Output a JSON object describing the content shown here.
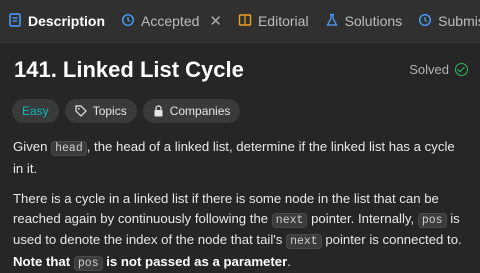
{
  "tabs": [
    {
      "label": "Description",
      "icon": "document-icon"
    },
    {
      "label": "Accepted",
      "icon": "history-icon"
    },
    {
      "label": "Editorial",
      "icon": "book-icon"
    },
    {
      "label": "Solutions",
      "icon": "flask-icon"
    },
    {
      "label": "Submissions",
      "icon": "history-icon"
    }
  ],
  "close_glyph": "✕",
  "problem": {
    "title": "141. Linked List Cycle",
    "status": "Solved"
  },
  "tags": [
    {
      "label": "Easy"
    },
    {
      "label": "Topics",
      "icon": "tag-icon"
    },
    {
      "label": "Companies",
      "icon": "lock-icon"
    }
  ],
  "description": {
    "p1": [
      "Given ",
      "head",
      ", the head of a linked list, determine if the linked list has a cycle in it."
    ],
    "p2": [
      "There is a cycle in a linked list if there is some node in the list that can be reached again by continuously following the ",
      "next",
      " pointer. Internally, ",
      "pos",
      " is used to denote the index of the node that tail's ",
      "next",
      " pointer is connected to. ",
      "Note that ",
      "pos",
      " is not passed as a parameter",
      "."
    ]
  },
  "colors": {
    "accent_easy": "#10b8b8",
    "solved_check": "#2cbb5d",
    "background": "#262626"
  }
}
